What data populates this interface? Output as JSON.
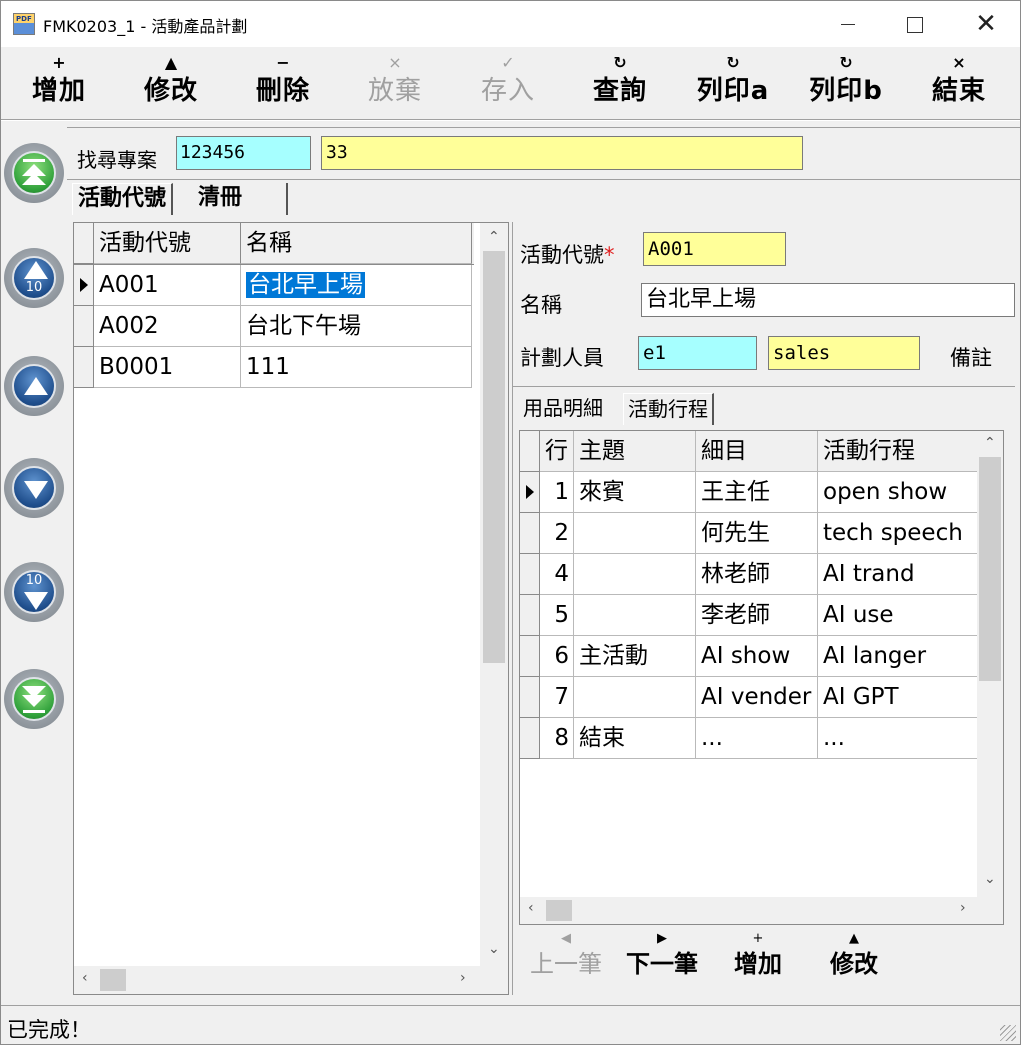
{
  "window": {
    "app_icon": "app-icon",
    "app_icon_text": "PDF",
    "title": "FMK0203_1 - 活動產品計劃",
    "minimize": "minimize-icon",
    "maximize": "maximize-icon",
    "close": "✕"
  },
  "toolbar": [
    {
      "icon": "+",
      "label": "增加",
      "enabled": true
    },
    {
      "icon": "▲",
      "label": "修改",
      "enabled": true
    },
    {
      "icon": "−",
      "label": "刪除",
      "enabled": true
    },
    {
      "icon": "×",
      "label": "放棄",
      "enabled": false
    },
    {
      "icon": "✓",
      "label": "存入",
      "enabled": false
    },
    {
      "icon": "↻",
      "label": "查詢",
      "enabled": true
    },
    {
      "icon": "↻",
      "label": "列印a",
      "enabled": true
    },
    {
      "icon": "↻",
      "label": "列印b",
      "enabled": true
    },
    {
      "icon": "×",
      "label": "結束",
      "enabled": true
    }
  ],
  "nav_buttons": [
    "first-record-icon",
    "up-10-icon",
    "up-icon",
    "down-icon",
    "down-10-icon",
    "last-record-icon"
  ],
  "nav_ten": "10",
  "search": {
    "label": "找尋專案",
    "code": "123456",
    "name": "33"
  },
  "main_tabs": [
    "活動代號",
    "清冊"
  ],
  "list": {
    "columns": [
      "活動代號",
      "名稱"
    ],
    "rows": [
      {
        "code": "A001",
        "name": "台北早上場"
      },
      {
        "code": "A002",
        "name": "台北下午場"
      },
      {
        "code": "B0001",
        "name": "111"
      }
    ]
  },
  "detail": {
    "code_label": "活動代號",
    "required_mark": "*",
    "code_value": "A001",
    "name_label": "名稱",
    "name_value": "台北早上場",
    "planner_label": "計劃人員",
    "planner_code": "e1",
    "planner_name": "sales",
    "remark_label": "備註"
  },
  "sub_tabs": [
    "用品明細",
    "活動行程"
  ],
  "schedule": {
    "columns": [
      "行",
      "主題",
      "細目",
      "活動行程"
    ],
    "rows": [
      {
        "line": "1",
        "topic": "來賓",
        "item": "王主任",
        "schedule": "open show"
      },
      {
        "line": "2",
        "topic": "",
        "item": "何先生",
        "schedule": "tech speech"
      },
      {
        "line": "4",
        "topic": "",
        "item": "林老師",
        "schedule": "AI trand"
      },
      {
        "line": "5",
        "topic": "",
        "item": "李老師",
        "schedule": "AI use"
      },
      {
        "line": "6",
        "topic": "主活動",
        "item": "AI show",
        "schedule": "AI langer"
      },
      {
        "line": "7",
        "topic": "",
        "item": "AI vender",
        "schedule": "AI GPT"
      },
      {
        "line": "8",
        "topic": "結束",
        "item": "...",
        "schedule": "..."
      }
    ]
  },
  "sub_nav": [
    {
      "icon": "◀",
      "label": "上一筆",
      "enabled": false
    },
    {
      "icon": "▶",
      "label": "下一筆",
      "enabled": true
    },
    {
      "icon": "+",
      "label": "增加",
      "enabled": true
    },
    {
      "icon": "▲",
      "label": "修改",
      "enabled": true
    }
  ],
  "status": "已完成！"
}
